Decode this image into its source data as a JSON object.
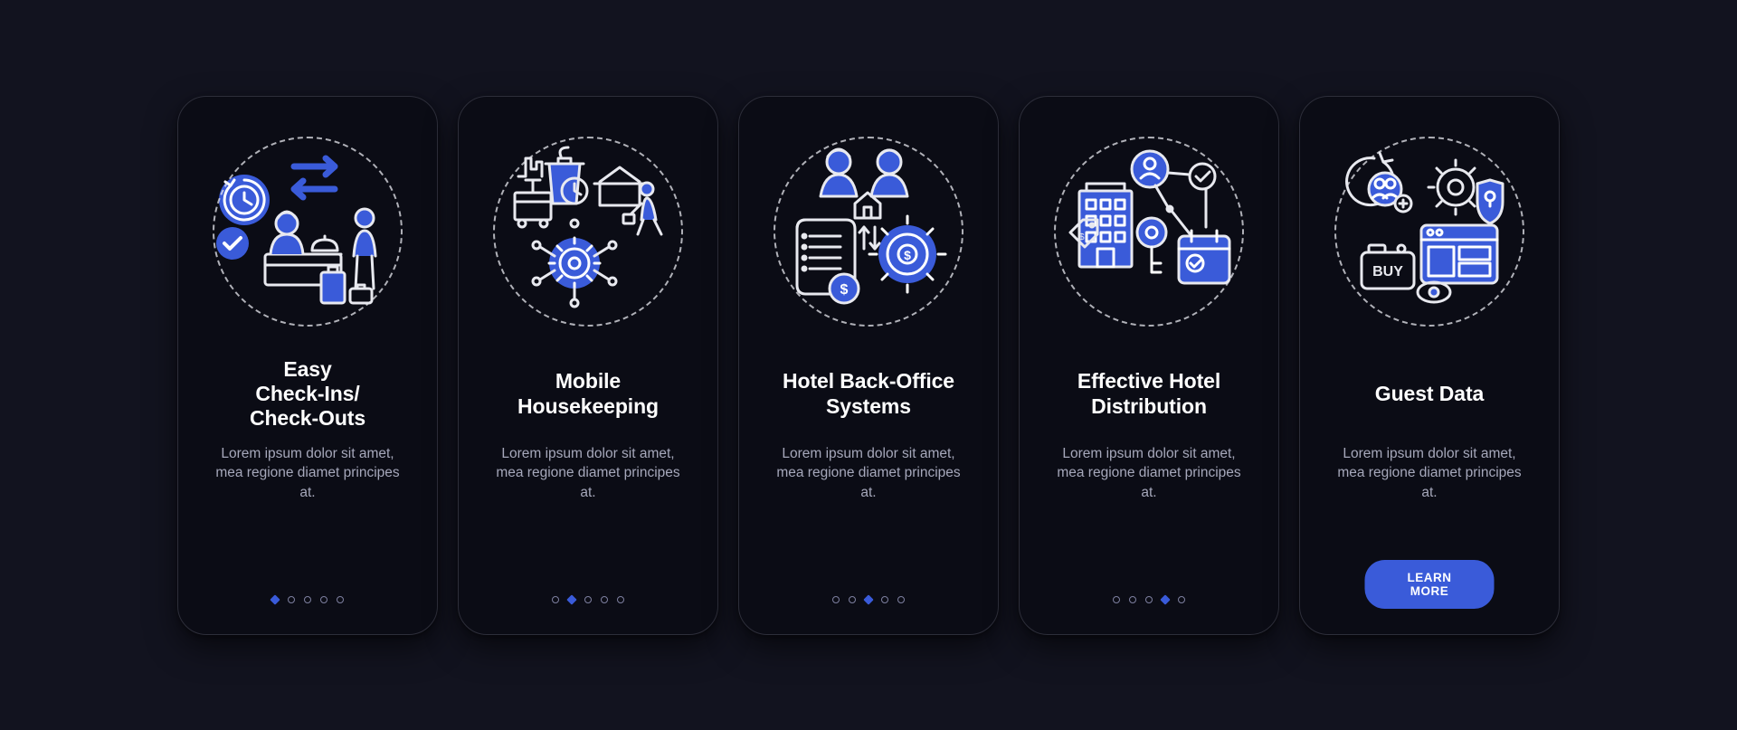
{
  "colors": {
    "accent": "#3a5bd9",
    "line": "#e8e9ef",
    "bg": "#12131f",
    "card": "#0b0c15"
  },
  "cards": [
    {
      "title": "Easy\nCheck-Ins/\nCheck-Outs",
      "desc": "Lorem ipsum dolor sit amet, mea regione diamet principes at.",
      "active_dot": 0,
      "has_button": false,
      "icon": "checkin-checkout-icon"
    },
    {
      "title": "Mobile\nHousekeeping",
      "desc": "Lorem ipsum dolor sit amet, mea regione diamet principes at.",
      "active_dot": 1,
      "has_button": false,
      "icon": "mobile-housekeeping-icon"
    },
    {
      "title": "Hotel Back-Office\nSystems",
      "desc": "Lorem ipsum dolor sit amet, mea regione diamet principes at.",
      "active_dot": 2,
      "has_button": false,
      "icon": "back-office-icon"
    },
    {
      "title": "Effective Hotel\nDistribution",
      "desc": "Lorem ipsum dolor sit amet, mea regione diamet principes at.",
      "active_dot": 3,
      "has_button": false,
      "icon": "hotel-distribution-icon"
    },
    {
      "title": "Guest Data",
      "desc": "Lorem ipsum dolor sit amet, mea regione diamet principes at.",
      "active_dot": -1,
      "has_button": true,
      "button_label": "LEARN MORE",
      "icon": "guest-data-icon"
    }
  ],
  "dots_count": 5
}
